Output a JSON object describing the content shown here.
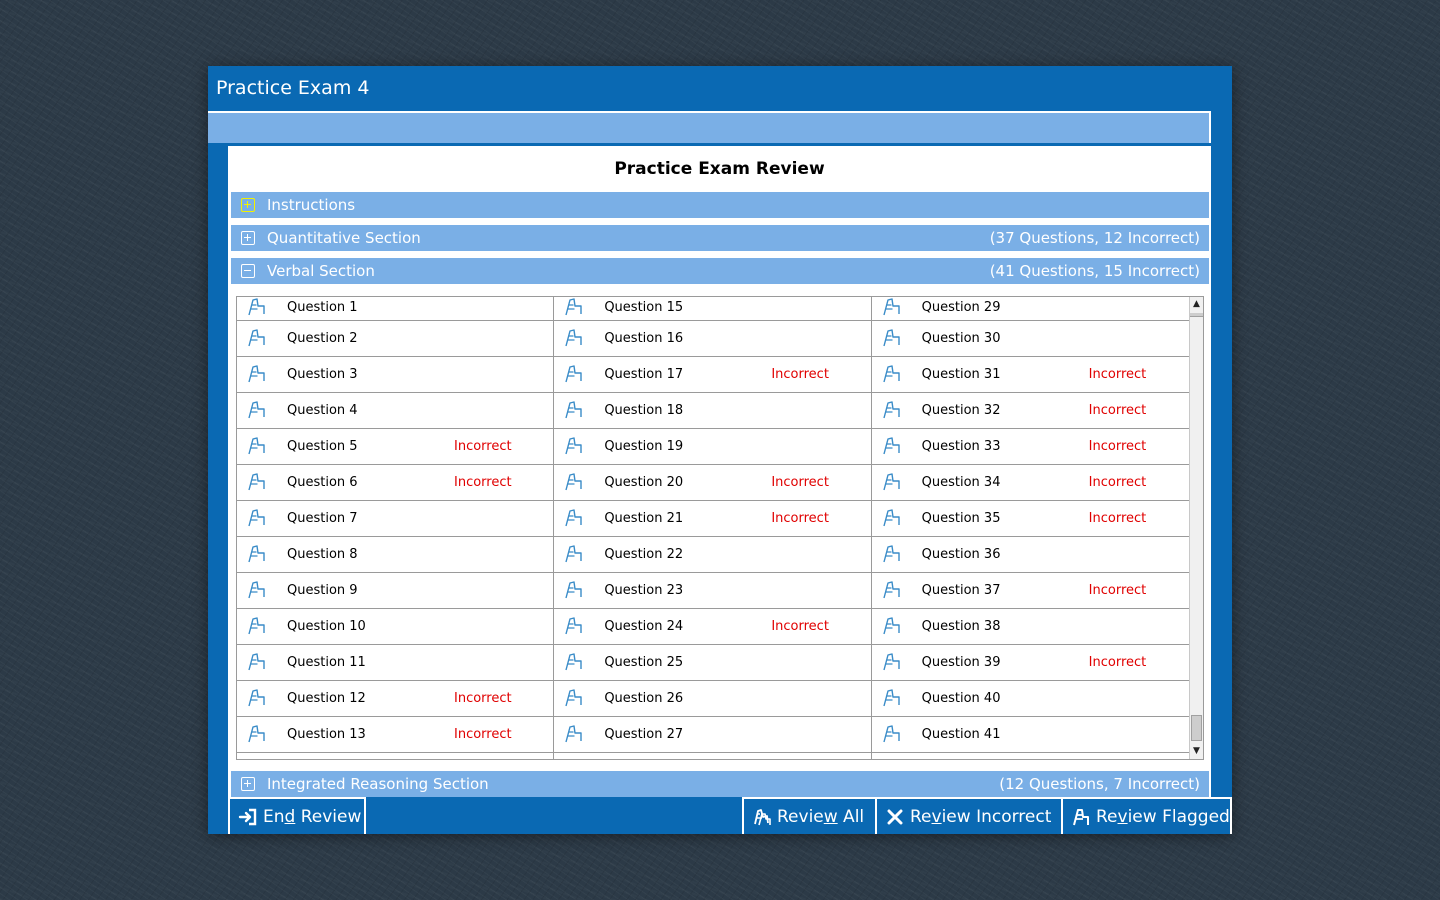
{
  "window": {
    "title": "Practice Exam 4"
  },
  "review": {
    "title": "Practice Exam Review"
  },
  "sections": {
    "instructions": {
      "label": "Instructions"
    },
    "quantitative": {
      "label": "Quantitative Section",
      "summary": "(37 Questions, 12 Incorrect)"
    },
    "verbal": {
      "label": "Verbal Section",
      "summary": "(41 Questions, 15 Incorrect)"
    },
    "integrated": {
      "label": "Integrated Reasoning Section",
      "summary": "(12 Questions, 7 Incorrect)"
    }
  },
  "verbal_questions": [
    [
      {
        "label": "Question 1",
        "status": ""
      },
      {
        "label": "Question 2",
        "status": ""
      },
      {
        "label": "Question 3",
        "status": ""
      },
      {
        "label": "Question 4",
        "status": ""
      },
      {
        "label": "Question 5",
        "status": "Incorrect"
      },
      {
        "label": "Question 6",
        "status": "Incorrect"
      },
      {
        "label": "Question 7",
        "status": ""
      },
      {
        "label": "Question 8",
        "status": ""
      },
      {
        "label": "Question 9",
        "status": ""
      },
      {
        "label": "Question 10",
        "status": ""
      },
      {
        "label": "Question 11",
        "status": ""
      },
      {
        "label": "Question 12",
        "status": "Incorrect"
      },
      {
        "label": "Question 13",
        "status": "Incorrect"
      }
    ],
    [
      {
        "label": "Question 15",
        "status": ""
      },
      {
        "label": "Question 16",
        "status": ""
      },
      {
        "label": "Question 17",
        "status": "Incorrect"
      },
      {
        "label": "Question 18",
        "status": ""
      },
      {
        "label": "Question 19",
        "status": ""
      },
      {
        "label": "Question 20",
        "status": "Incorrect"
      },
      {
        "label": "Question 21",
        "status": "Incorrect"
      },
      {
        "label": "Question 22",
        "status": ""
      },
      {
        "label": "Question 23",
        "status": ""
      },
      {
        "label": "Question 24",
        "status": "Incorrect"
      },
      {
        "label": "Question 25",
        "status": ""
      },
      {
        "label": "Question 26",
        "status": ""
      },
      {
        "label": "Question 27",
        "status": ""
      }
    ],
    [
      {
        "label": "Question 29",
        "status": ""
      },
      {
        "label": "Question 30",
        "status": ""
      },
      {
        "label": "Question 31",
        "status": "Incorrect"
      },
      {
        "label": "Question 32",
        "status": "Incorrect"
      },
      {
        "label": "Question 33",
        "status": "Incorrect"
      },
      {
        "label": "Question 34",
        "status": "Incorrect"
      },
      {
        "label": "Question 35",
        "status": "Incorrect"
      },
      {
        "label": "Question 36",
        "status": ""
      },
      {
        "label": "Question 37",
        "status": "Incorrect"
      },
      {
        "label": "Question 38",
        "status": ""
      },
      {
        "label": "Question 39",
        "status": "Incorrect"
      },
      {
        "label": "Question 40",
        "status": ""
      },
      {
        "label": "Question 41",
        "status": ""
      }
    ]
  ],
  "buttons": {
    "end_review": {
      "label_pre": "En",
      "label_ul": "d",
      "label_post": " Review",
      "icon": "exit-icon"
    },
    "review_all": {
      "label_pre": "Revie",
      "label_ul": "w",
      "label_post": " All",
      "icon": "review-all-icon"
    },
    "review_incorrect": {
      "label_pre": "Re",
      "label_ul": "v",
      "label_post": "iew Incorrect",
      "icon": "x-icon"
    },
    "review_flagged": {
      "label_pre": "Re",
      "label_ul": "v",
      "label_post": "iew Flagged",
      "icon": "flag-icon"
    }
  },
  "colors": {
    "frame": "#0a69b3",
    "section_bar": "#7aafe6",
    "incorrect": "#e00000",
    "flag_outline": "#3a8cc8",
    "instructions_toggle": "#f2f200"
  }
}
